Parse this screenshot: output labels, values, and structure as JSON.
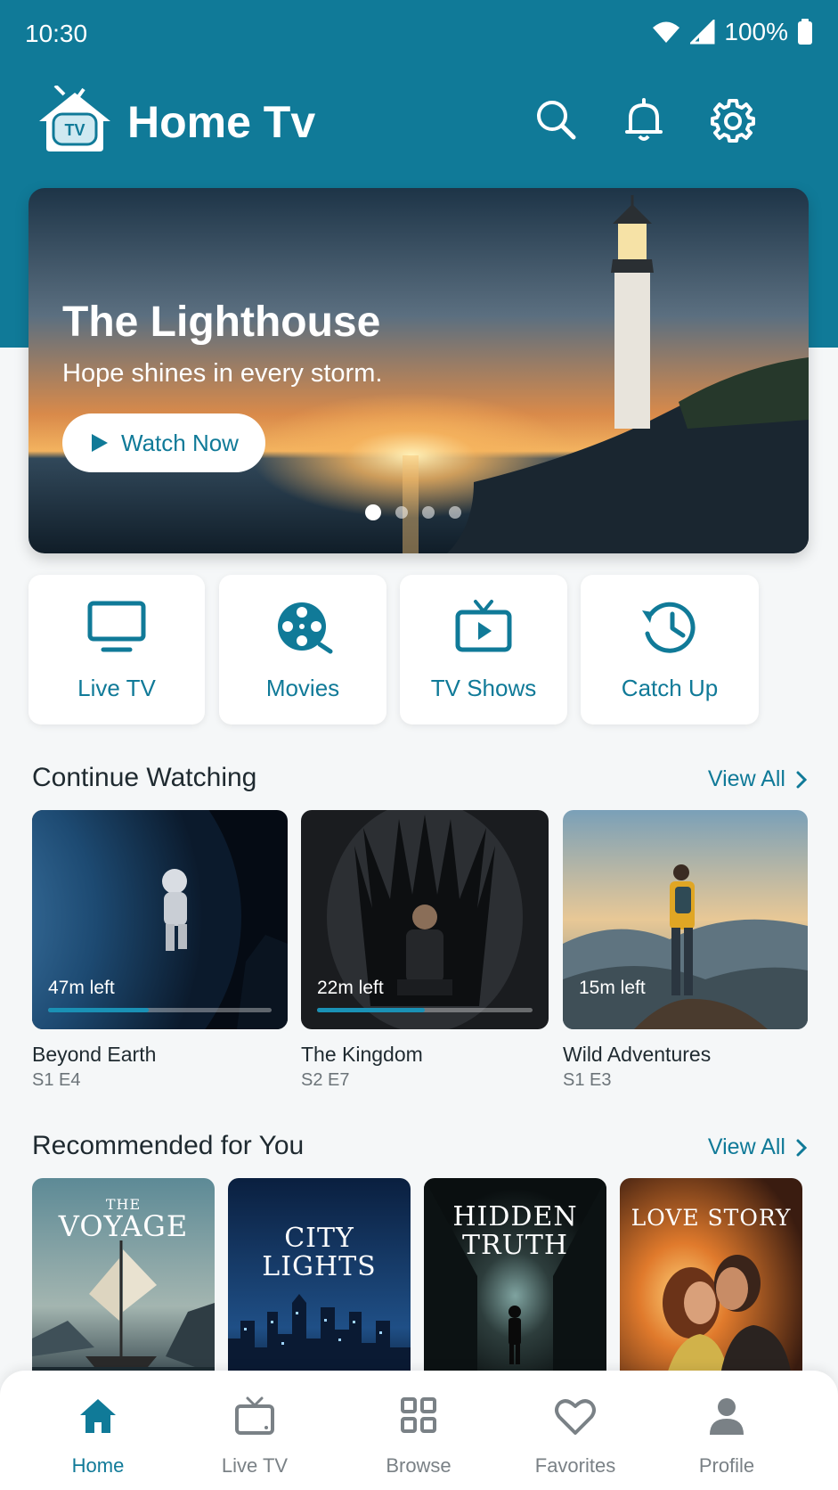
{
  "status_bar": {
    "time": "10:30",
    "battery": "100%"
  },
  "header": {
    "title": "Home Tv",
    "logo_text": "TV"
  },
  "hero": {
    "title": "The Lighthouse",
    "subtitle": "Hope shines in every storm.",
    "button_label": "Watch Now",
    "slide_count": 4,
    "active_slide": 1
  },
  "categories": [
    {
      "label": "Live TV",
      "icon": "monitor-icon"
    },
    {
      "label": "Movies",
      "icon": "film-reel-icon"
    },
    {
      "label": "TV Shows",
      "icon": "tv-play-icon"
    },
    {
      "label": "Catch Up",
      "icon": "history-icon"
    }
  ],
  "continue_watching": {
    "title": "Continue Watching",
    "view_all": "View All",
    "items": [
      {
        "name": "Beyond Earth",
        "episode": "S1 E4",
        "time_left": "47m left",
        "progress": 0.45
      },
      {
        "name": "The Kingdom",
        "episode": "S2 E7",
        "time_left": "22m left",
        "progress": 0.5
      },
      {
        "name": "Wild Adventures",
        "episode": "S1 E3",
        "time_left": "15m left",
        "progress": 0.0
      }
    ]
  },
  "recommended": {
    "title": "Recommended for You",
    "view_all": "View All",
    "items": [
      {
        "small": "THE",
        "big": "VOYAGE"
      },
      {
        "line1": "CITY",
        "line2": "LIGHTS"
      },
      {
        "line1": "HIDDEN",
        "line2": "TRUTH"
      },
      {
        "line1": "LOVE STORY"
      }
    ]
  },
  "bottom_nav": [
    {
      "label": "Home",
      "icon": "home-icon",
      "active": true
    },
    {
      "label": "Live TV",
      "icon": "tv-icon"
    },
    {
      "label": "Browse",
      "icon": "grid-icon"
    },
    {
      "label": "Favorites",
      "icon": "heart-icon"
    },
    {
      "label": "Profile",
      "icon": "person-icon"
    }
  ],
  "colors": {
    "primary": "#107a98",
    "accent": "#1a91b5",
    "background": "#f5f7f8"
  }
}
